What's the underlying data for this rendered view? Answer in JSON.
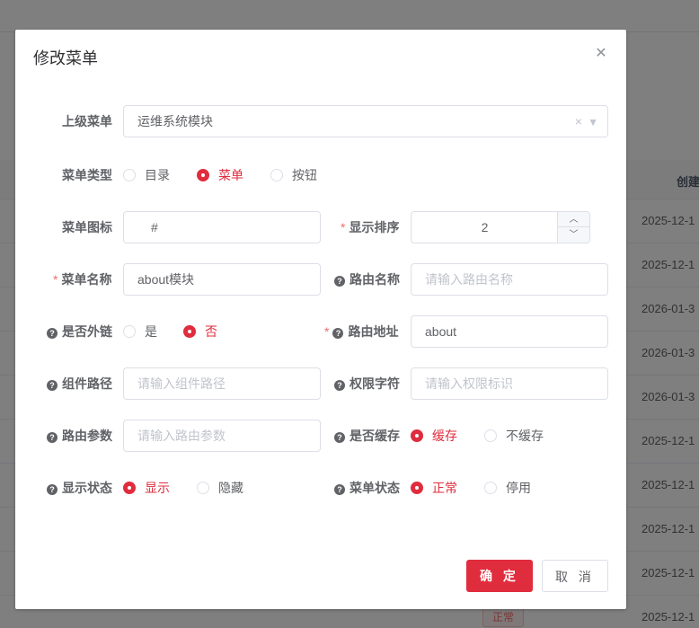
{
  "background": {
    "column_title": "创建",
    "dates": [
      "2025-12-1",
      "2025-12-1",
      "2026-01-3",
      "2026-01-3",
      "2026-01-3",
      "2025-12-1",
      "2025-12-1",
      "2025-12-1",
      "2025-12-1",
      "2025-12-1"
    ],
    "tag": "正常"
  },
  "dialog": {
    "title": "修改菜单",
    "parent_menu": {
      "label": "上级菜单",
      "value": "运维系统模块"
    },
    "menu_type": {
      "label": "菜单类型",
      "options": [
        "目录",
        "菜单",
        "按钮"
      ],
      "selected": "菜单"
    },
    "menu_icon": {
      "label": "菜单图标",
      "value": "#"
    },
    "display_order": {
      "label": "显示排序",
      "value": "2"
    },
    "menu_name": {
      "label": "菜单名称",
      "value": "about模块"
    },
    "route_name": {
      "label": "路由名称",
      "placeholder": "请输入路由名称"
    },
    "is_external": {
      "label": "是否外链",
      "options": [
        "是",
        "否"
      ],
      "selected": "否"
    },
    "route_path": {
      "label": "路由地址",
      "value": "about"
    },
    "component_path": {
      "label": "组件路径",
      "placeholder": "请输入组件路径"
    },
    "permission": {
      "label": "权限字符",
      "placeholder": "请输入权限标识"
    },
    "route_params": {
      "label": "路由参数",
      "placeholder": "请输入路由参数"
    },
    "cache": {
      "label": "是否缓存",
      "options": [
        "缓存",
        "不缓存"
      ],
      "selected": "缓存"
    },
    "visible": {
      "label": "显示状态",
      "options": [
        "显示",
        "隐藏"
      ],
      "selected": "显示"
    },
    "status": {
      "label": "菜单状态",
      "options": [
        "正常",
        "停用"
      ],
      "selected": "正常"
    },
    "confirm_label": "确 定",
    "cancel_label": "取 消"
  },
  "colors": {
    "primary": "#e02d3e",
    "required": "#f56c6c"
  }
}
